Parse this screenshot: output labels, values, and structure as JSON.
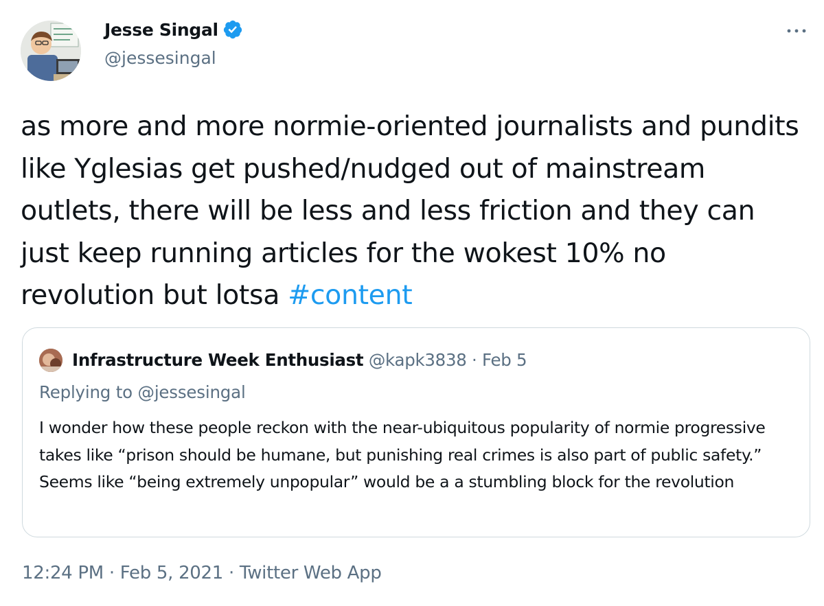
{
  "author": {
    "name": "Jesse Singal",
    "handle": "@jessesingal",
    "verified_icon": "verified-badge-icon",
    "verified_color": "#1d9bf0"
  },
  "tweet": {
    "text": "as more and more normie-oriented journalists and pundits like Yglesias get pushed/nudged out of mainstream outlets, there will be less and less friction and they can just keep running articles for the wokest 10% no revolution but lotsa ",
    "hashtag": "#content"
  },
  "quoted_tweet": {
    "author_name": "Infrastructure Week Enthusiast",
    "author_handle": "@kapk3838",
    "separator": " · ",
    "date": "Feb 5",
    "replying_prefix": "Replying to ",
    "replying_handle": "@jessesingal",
    "text": "I wonder how these people reckon with the near-ubiquitous popularity of normie progressive takes like “prison should be humane, but punishing real crimes is also part of public safety.” Seems like “being extremely unpopular” would be a a stumbling block for the revolution"
  },
  "meta": {
    "timestamp": "12:24 PM · Feb 5, 2021 · Twitter Web App"
  },
  "colors": {
    "text": "#0f1419",
    "secondary": "#5b7083",
    "accent": "#1d9bf0",
    "border": "#cfd9de"
  }
}
